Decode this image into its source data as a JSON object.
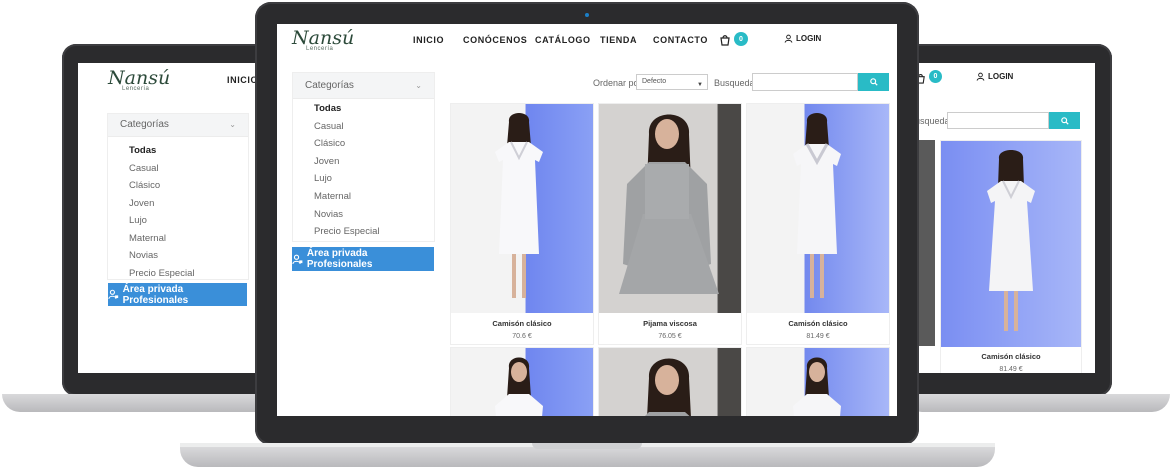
{
  "brand": {
    "logo_text": "Nansú",
    "logo_sub": "Lencería"
  },
  "nav": {
    "home": "INICIO",
    "about": "CONÓCENOS",
    "catalog": "CATÁLOGO",
    "store": "TIENDA",
    "contact": "CONTACTO",
    "cart_count": "0",
    "login": "LOGIN"
  },
  "sidebar": {
    "title": "Categorías",
    "items": [
      "Todas",
      "Casual",
      "Clásico",
      "Joven",
      "Lujo",
      "Maternal",
      "Novias",
      "Precio Especial"
    ],
    "pro_button": "Área privada Profesionales"
  },
  "toolbar": {
    "order_label": "Ordenar por:",
    "order_value": "Defecto",
    "search_label": "Busqueda:",
    "search_value": ""
  },
  "products": [
    {
      "name": "Camisón clásico",
      "price": "70.6 €"
    },
    {
      "name": "Pijama viscosa",
      "price": "76.05 €"
    },
    {
      "name": "Camisón clásico",
      "price": "81.49 €"
    }
  ],
  "right_screen": {
    "search_label": "Busqueda:",
    "product": {
      "name": "Camisón clásico",
      "price": "81.49 €"
    }
  },
  "colors": {
    "accent": "#29bbc6",
    "pro_button": "#3a8fd9",
    "laptop_frame": "#2b2b2d",
    "photo_bg_blue": "#6f86ef"
  }
}
